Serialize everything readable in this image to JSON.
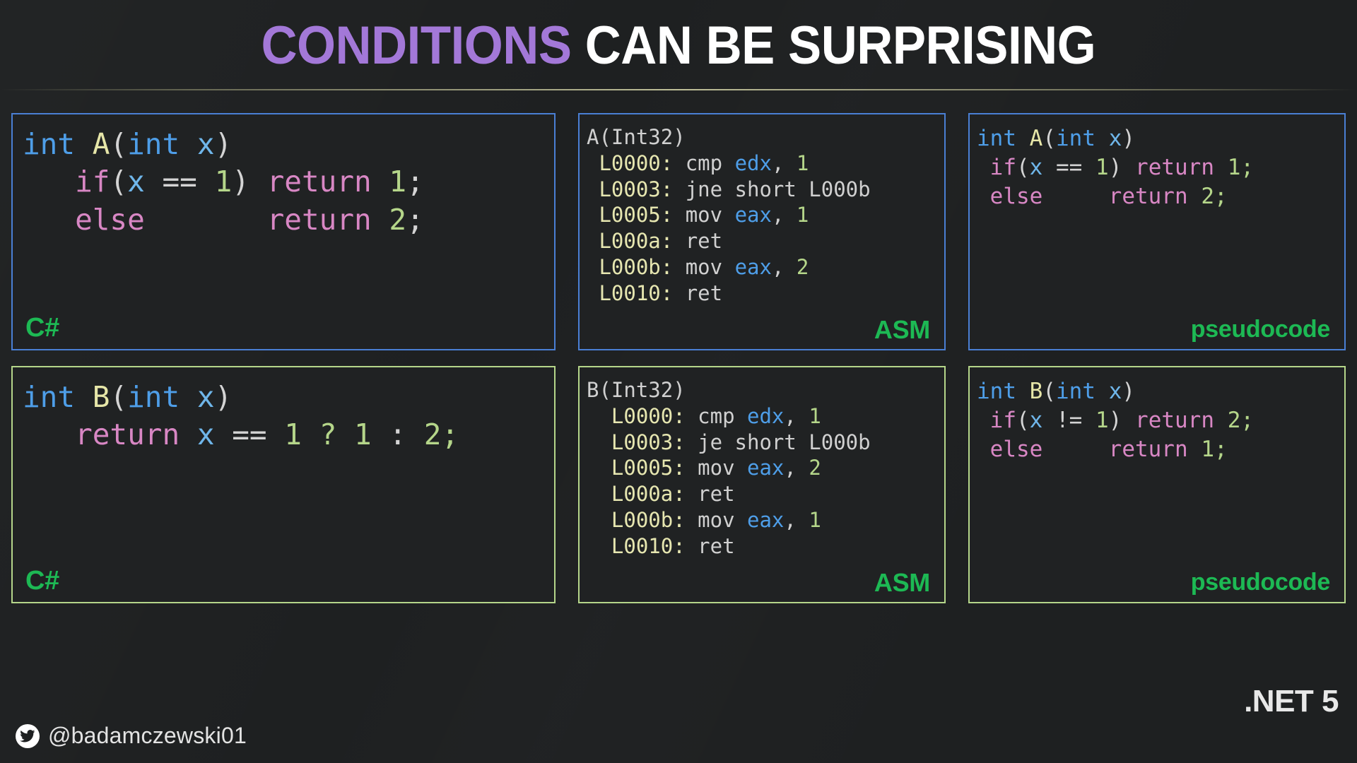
{
  "title": {
    "keyword": "CONDITIONS",
    "rest": "CAN BE SURPRISING",
    "keyword_color": "#a378d8",
    "rest_color": "#ffffff"
  },
  "colors": {
    "background": "#1e2021",
    "panel_background": "#202223",
    "border_row_a": "#4a7fd4",
    "border_row_b": "#b5d68a",
    "badge_green": "#1db954",
    "divider": "#e8e8b8"
  },
  "panels": [
    {
      "id": "csharp-a",
      "row": "a",
      "kind": "cs",
      "badge": "C#",
      "lines": [
        [
          {
            "t": "int",
            "c": "type"
          },
          {
            "t": " ",
            "c": "plain"
          },
          {
            "t": "A",
            "c": "fn"
          },
          {
            "t": "(",
            "c": "punc"
          },
          {
            "t": "int",
            "c": "type"
          },
          {
            "t": " ",
            "c": "plain"
          },
          {
            "t": "x",
            "c": "var"
          },
          {
            "t": ")",
            "c": "punc"
          }
        ],
        [
          {
            "t": "   ",
            "c": "plain"
          },
          {
            "t": "if",
            "c": "kw"
          },
          {
            "t": "(",
            "c": "punc"
          },
          {
            "t": "x",
            "c": "var"
          },
          {
            "t": " ",
            "c": "plain"
          },
          {
            "t": "==",
            "c": "punc"
          },
          {
            "t": " ",
            "c": "plain"
          },
          {
            "t": "1",
            "c": "num"
          },
          {
            "t": ")",
            "c": "punc"
          },
          {
            "t": " ",
            "c": "plain"
          },
          {
            "t": "return",
            "c": "kw"
          },
          {
            "t": " ",
            "c": "plain"
          },
          {
            "t": "1",
            "c": "num"
          },
          {
            "t": ";",
            "c": "punc"
          }
        ],
        [
          {
            "t": "   ",
            "c": "plain"
          },
          {
            "t": "else",
            "c": "kw"
          },
          {
            "t": "       ",
            "c": "plain"
          },
          {
            "t": "return",
            "c": "kw"
          },
          {
            "t": " ",
            "c": "plain"
          },
          {
            "t": "2",
            "c": "num"
          },
          {
            "t": ";",
            "c": "punc"
          }
        ]
      ]
    },
    {
      "id": "asm-a",
      "row": "a",
      "kind": "asm",
      "badge": "ASM",
      "lines": [
        [
          {
            "t": "A(Int32)",
            "c": "plain"
          }
        ],
        [
          {
            "t": " ",
            "c": "plain"
          },
          {
            "t": "L0000:",
            "c": "label"
          },
          {
            "t": " ",
            "c": "plain"
          },
          {
            "t": "cmp",
            "c": "plain"
          },
          {
            "t": " ",
            "c": "plain"
          },
          {
            "t": "edx",
            "c": "reg"
          },
          {
            "t": ",",
            "c": "plain"
          },
          {
            "t": " ",
            "c": "plain"
          },
          {
            "t": "1",
            "c": "num"
          }
        ],
        [
          {
            "t": " ",
            "c": "plain"
          },
          {
            "t": "L0003:",
            "c": "label"
          },
          {
            "t": " ",
            "c": "plain"
          },
          {
            "t": "jne short L000b",
            "c": "plain"
          }
        ],
        [
          {
            "t": " ",
            "c": "plain"
          },
          {
            "t": "L0005:",
            "c": "label"
          },
          {
            "t": " ",
            "c": "plain"
          },
          {
            "t": "mov",
            "c": "plain"
          },
          {
            "t": " ",
            "c": "plain"
          },
          {
            "t": "eax",
            "c": "reg"
          },
          {
            "t": ",",
            "c": "plain"
          },
          {
            "t": " ",
            "c": "plain"
          },
          {
            "t": "1",
            "c": "num"
          }
        ],
        [
          {
            "t": " ",
            "c": "plain"
          },
          {
            "t": "L000a:",
            "c": "label"
          },
          {
            "t": " ",
            "c": "plain"
          },
          {
            "t": "ret",
            "c": "plain"
          }
        ],
        [
          {
            "t": " ",
            "c": "plain"
          },
          {
            "t": "L000b:",
            "c": "label"
          },
          {
            "t": " ",
            "c": "plain"
          },
          {
            "t": "mov",
            "c": "plain"
          },
          {
            "t": " ",
            "c": "plain"
          },
          {
            "t": "eax",
            "c": "reg"
          },
          {
            "t": ",",
            "c": "plain"
          },
          {
            "t": " ",
            "c": "plain"
          },
          {
            "t": "2",
            "c": "num"
          }
        ],
        [
          {
            "t": " ",
            "c": "plain"
          },
          {
            "t": "L0010:",
            "c": "label"
          },
          {
            "t": " ",
            "c": "plain"
          },
          {
            "t": "ret",
            "c": "plain"
          }
        ]
      ]
    },
    {
      "id": "pseudo-a",
      "row": "a",
      "kind": "pseudo",
      "badge": "pseudocode",
      "lines": [
        [
          {
            "t": "int",
            "c": "type"
          },
          {
            "t": " ",
            "c": "plain"
          },
          {
            "t": "A",
            "c": "fn"
          },
          {
            "t": "(",
            "c": "punc"
          },
          {
            "t": "int",
            "c": "type"
          },
          {
            "t": " ",
            "c": "plain"
          },
          {
            "t": "x",
            "c": "var"
          },
          {
            "t": ")",
            "c": "punc"
          }
        ],
        [
          {
            "t": " ",
            "c": "plain"
          },
          {
            "t": "if",
            "c": "kw"
          },
          {
            "t": "(",
            "c": "punc"
          },
          {
            "t": "x",
            "c": "var"
          },
          {
            "t": " ",
            "c": "plain"
          },
          {
            "t": "==",
            "c": "punc"
          },
          {
            "t": " ",
            "c": "plain"
          },
          {
            "t": "1",
            "c": "num"
          },
          {
            "t": ")",
            "c": "punc"
          },
          {
            "t": " ",
            "c": "plain"
          },
          {
            "t": "return",
            "c": "kw"
          },
          {
            "t": " ",
            "c": "plain"
          },
          {
            "t": "1",
            "c": "num"
          },
          {
            "t": ";",
            "c": "num"
          }
        ],
        [
          {
            "t": " ",
            "c": "plain"
          },
          {
            "t": "else",
            "c": "kw"
          },
          {
            "t": "     ",
            "c": "plain"
          },
          {
            "t": "return",
            "c": "kw"
          },
          {
            "t": " ",
            "c": "plain"
          },
          {
            "t": "2",
            "c": "num"
          },
          {
            "t": ";",
            "c": "num"
          }
        ]
      ]
    },
    {
      "id": "csharp-b",
      "row": "b",
      "kind": "cs",
      "badge": "C#",
      "lines": [
        [
          {
            "t": "int",
            "c": "type"
          },
          {
            "t": " ",
            "c": "plain"
          },
          {
            "t": "B",
            "c": "fn"
          },
          {
            "t": "(",
            "c": "punc"
          },
          {
            "t": "int",
            "c": "type"
          },
          {
            "t": " ",
            "c": "plain"
          },
          {
            "t": "x",
            "c": "var"
          },
          {
            "t": ")",
            "c": "punc"
          }
        ],
        [
          {
            "t": "   ",
            "c": "plain"
          },
          {
            "t": "return",
            "c": "kw"
          },
          {
            "t": " ",
            "c": "plain"
          },
          {
            "t": "x",
            "c": "var"
          },
          {
            "t": " ",
            "c": "plain"
          },
          {
            "t": "==",
            "c": "punc"
          },
          {
            "t": " ",
            "c": "plain"
          },
          {
            "t": "1",
            "c": "num"
          },
          {
            "t": " ",
            "c": "plain"
          },
          {
            "t": "?",
            "c": "num"
          },
          {
            "t": " ",
            "c": "plain"
          },
          {
            "t": "1",
            "c": "num"
          },
          {
            "t": " ",
            "c": "plain"
          },
          {
            "t": ":",
            "c": "punc"
          },
          {
            "t": " ",
            "c": "plain"
          },
          {
            "t": "2",
            "c": "num"
          },
          {
            "t": ";",
            "c": "num"
          }
        ]
      ]
    },
    {
      "id": "asm-b",
      "row": "b",
      "kind": "asm",
      "badge": "ASM",
      "lines": [
        [
          {
            "t": "B(Int32)",
            "c": "plain"
          }
        ],
        [
          {
            "t": "  ",
            "c": "plain"
          },
          {
            "t": "L0000:",
            "c": "label"
          },
          {
            "t": " ",
            "c": "plain"
          },
          {
            "t": "cmp",
            "c": "plain"
          },
          {
            "t": " ",
            "c": "plain"
          },
          {
            "t": "edx",
            "c": "reg"
          },
          {
            "t": ",",
            "c": "plain"
          },
          {
            "t": " ",
            "c": "plain"
          },
          {
            "t": "1",
            "c": "num"
          }
        ],
        [
          {
            "t": "  ",
            "c": "plain"
          },
          {
            "t": "L0003:",
            "c": "label"
          },
          {
            "t": " ",
            "c": "plain"
          },
          {
            "t": "je short L000b",
            "c": "plain"
          }
        ],
        [
          {
            "t": "  ",
            "c": "plain"
          },
          {
            "t": "L0005:",
            "c": "label"
          },
          {
            "t": " ",
            "c": "plain"
          },
          {
            "t": "mov",
            "c": "plain"
          },
          {
            "t": " ",
            "c": "plain"
          },
          {
            "t": "eax",
            "c": "reg"
          },
          {
            "t": ",",
            "c": "plain"
          },
          {
            "t": " ",
            "c": "plain"
          },
          {
            "t": "2",
            "c": "num"
          }
        ],
        [
          {
            "t": "  ",
            "c": "plain"
          },
          {
            "t": "L000a:",
            "c": "label"
          },
          {
            "t": " ",
            "c": "plain"
          },
          {
            "t": "ret",
            "c": "plain"
          }
        ],
        [
          {
            "t": "  ",
            "c": "plain"
          },
          {
            "t": "L000b:",
            "c": "label"
          },
          {
            "t": " ",
            "c": "plain"
          },
          {
            "t": "mov",
            "c": "plain"
          },
          {
            "t": " ",
            "c": "plain"
          },
          {
            "t": "eax",
            "c": "reg"
          },
          {
            "t": ",",
            "c": "plain"
          },
          {
            "t": " ",
            "c": "plain"
          },
          {
            "t": "1",
            "c": "num"
          }
        ],
        [
          {
            "t": "  ",
            "c": "plain"
          },
          {
            "t": "L0010:",
            "c": "label"
          },
          {
            "t": " ",
            "c": "plain"
          },
          {
            "t": "ret",
            "c": "plain"
          }
        ]
      ]
    },
    {
      "id": "pseudo-b",
      "row": "b",
      "kind": "pseudo",
      "badge": "pseudocode",
      "lines": [
        [
          {
            "t": "int",
            "c": "type"
          },
          {
            "t": " ",
            "c": "plain"
          },
          {
            "t": "B",
            "c": "fn"
          },
          {
            "t": "(",
            "c": "punc"
          },
          {
            "t": "int",
            "c": "type"
          },
          {
            "t": " ",
            "c": "plain"
          },
          {
            "t": "x",
            "c": "var"
          },
          {
            "t": ")",
            "c": "punc"
          }
        ],
        [
          {
            "t": " ",
            "c": "plain"
          },
          {
            "t": "if",
            "c": "kw"
          },
          {
            "t": "(",
            "c": "punc"
          },
          {
            "t": "x",
            "c": "var"
          },
          {
            "t": " ",
            "c": "plain"
          },
          {
            "t": "!=",
            "c": "punc"
          },
          {
            "t": " ",
            "c": "plain"
          },
          {
            "t": "1",
            "c": "num"
          },
          {
            "t": ")",
            "c": "punc"
          },
          {
            "t": " ",
            "c": "plain"
          },
          {
            "t": "return",
            "c": "kw"
          },
          {
            "t": " ",
            "c": "plain"
          },
          {
            "t": "2",
            "c": "num"
          },
          {
            "t": ";",
            "c": "num"
          }
        ],
        [
          {
            "t": " ",
            "c": "plain"
          },
          {
            "t": "else",
            "c": "kw"
          },
          {
            "t": "     ",
            "c": "plain"
          },
          {
            "t": "return",
            "c": "kw"
          },
          {
            "t": " ",
            "c": "plain"
          },
          {
            "t": "1",
            "c": "num"
          },
          {
            "t": ";",
            "c": "num"
          }
        ]
      ]
    }
  ],
  "footer": {
    "twitter_icon": "twitter-bird-icon",
    "handle": "@badamczewski01",
    "platform_label": ".NET 5"
  }
}
